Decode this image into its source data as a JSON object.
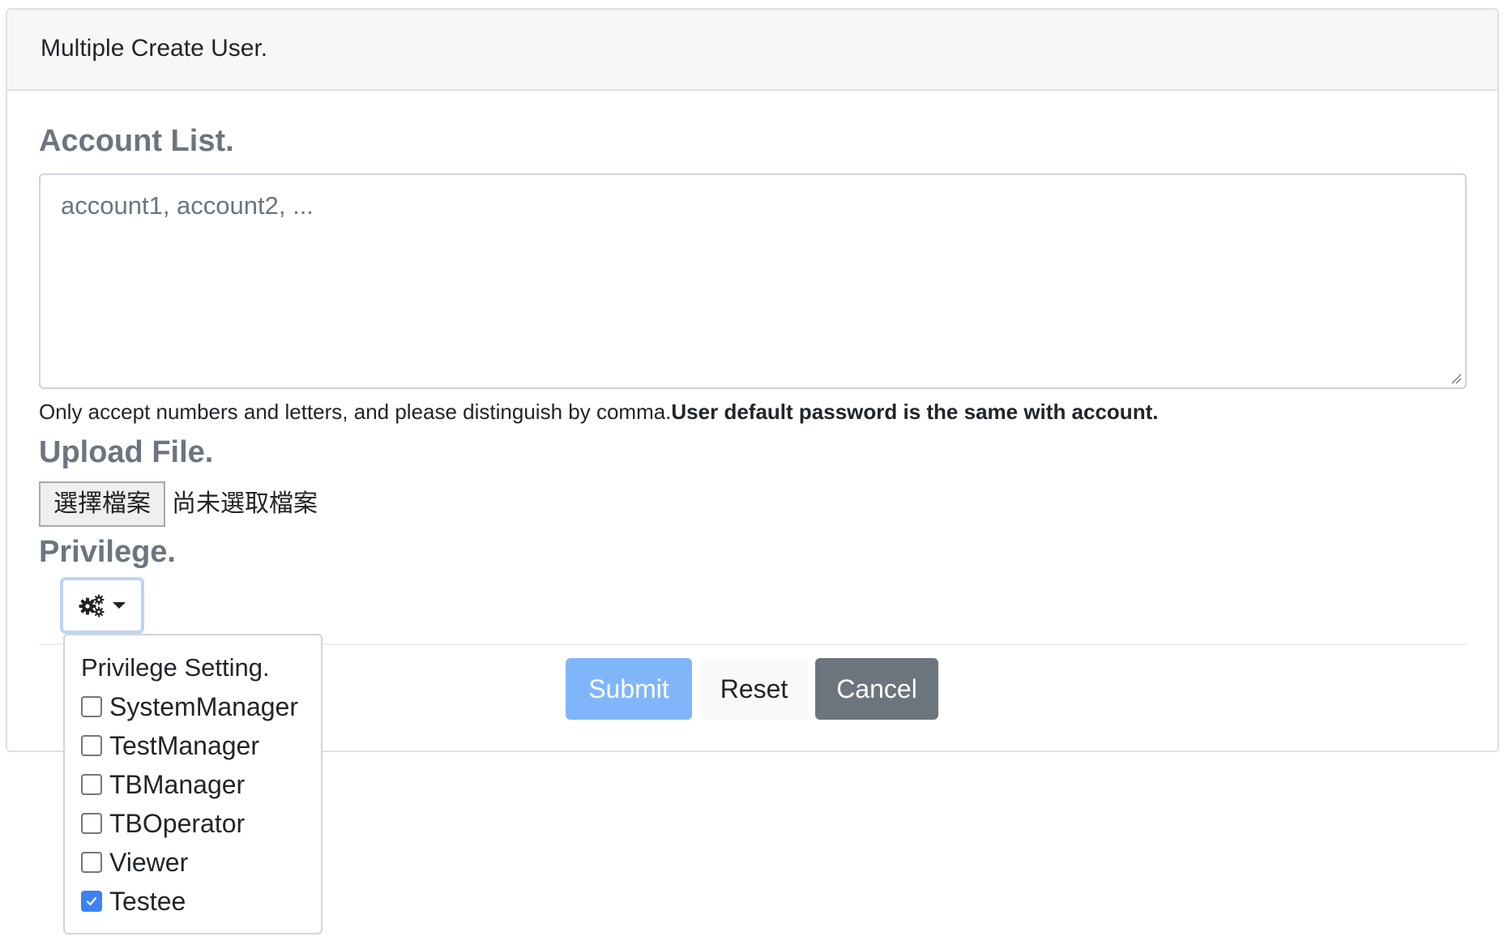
{
  "card": {
    "title": "Multiple Create User."
  },
  "account_list": {
    "label": "Account List.",
    "placeholder": "account1, account2, ...",
    "value": "",
    "help_text": "Only accept numbers and letters, and please distinguish by comma.",
    "help_text_bold": "User default password is the same with account."
  },
  "upload": {
    "label": "Upload File.",
    "button_label": "選擇檔案",
    "status": "尚未選取檔案"
  },
  "privilege": {
    "label": "Privilege.",
    "toggle_icon": "gears-icon",
    "caret_icon": "caret-down-icon",
    "dropdown": {
      "header": "Privilege Setting.",
      "options": [
        {
          "label": "SystemManager",
          "checked": false
        },
        {
          "label": "TestManager",
          "checked": false
        },
        {
          "label": "TBManager",
          "checked": false
        },
        {
          "label": "TBOperator",
          "checked": false
        },
        {
          "label": "Viewer",
          "checked": false
        },
        {
          "label": "Testee",
          "checked": true
        }
      ]
    }
  },
  "actions": {
    "submit_label": "Submit",
    "reset_label": "Reset",
    "cancel_label": "Cancel"
  },
  "colors": {
    "submit": "#80b6f9",
    "reset": "#f8f9fa",
    "cancel": "#6c757d",
    "checked": "#3b82f6",
    "label_gray": "#6c757d"
  }
}
